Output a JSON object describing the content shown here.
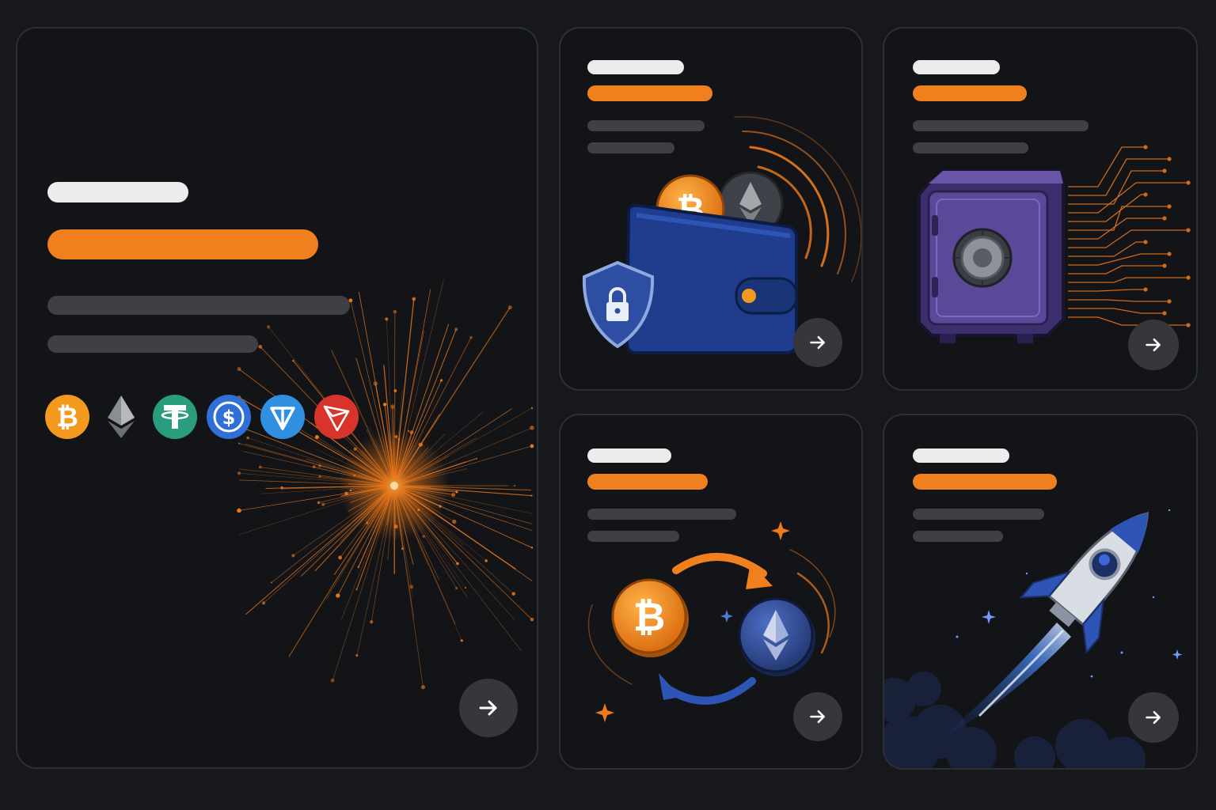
{
  "colors": {
    "background": "#16181c",
    "card": "#121418",
    "card_border": "#2c2f35",
    "accent": "#f0801e",
    "title_bar": "#ececec",
    "text_line": "#3e4046",
    "button": "#35373a"
  },
  "cards": [
    {
      "id": "main",
      "illustration": "orange-particle-burst",
      "coins": [
        "bitcoin-icon",
        "ethereum-icon",
        "tether-icon",
        "usdc-icon",
        "ton-icon",
        "tron-icon"
      ],
      "button_icon": "arrow-right-icon"
    },
    {
      "id": "wallet",
      "illustration": "wallet-with-coins-and-shield",
      "button_icon": "arrow-right-icon"
    },
    {
      "id": "vault",
      "illustration": "purple-safe-with-circuits",
      "button_icon": "arrow-right-icon"
    },
    {
      "id": "swap",
      "illustration": "bitcoin-ethereum-swap",
      "button_icon": "arrow-right-icon"
    },
    {
      "id": "launch",
      "illustration": "blue-rocket-launch",
      "button_icon": "arrow-right-icon"
    }
  ]
}
